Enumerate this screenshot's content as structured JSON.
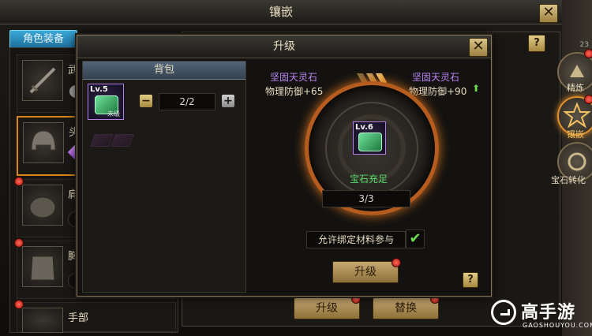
{
  "outer": {
    "title": "镶嵌",
    "close": "✕"
  },
  "left_panel": {
    "tab_label": "角色装备",
    "slots": [
      {
        "name": "武",
        "icon": "sword-icon"
      },
      {
        "name": "头",
        "icon": "helmet-icon"
      },
      {
        "name": "肩",
        "icon": "shoulder-icon"
      },
      {
        "name": "胸",
        "icon": "chest-armor-icon"
      },
      {
        "name": "手部",
        "icon": "gauntlet-icon"
      }
    ]
  },
  "side_tabs": [
    {
      "label": "精炼",
      "icon": "refine-icon"
    },
    {
      "label": "镶嵌",
      "icon": "inlay-icon"
    },
    {
      "label": "宝石转化",
      "icon": "gem-convert-icon"
    }
  ],
  "side_number": "23",
  "bottom_buttons": {
    "upgrade": "升级",
    "replace": "替换"
  },
  "help_label": "?",
  "dialog": {
    "title": "升级",
    "close": "✕",
    "bag": {
      "header": "背包",
      "item": {
        "level": "Lv.5",
        "status": "未级"
      },
      "quantity": "2/2",
      "minus": "−",
      "plus": "+"
    },
    "from_stone": {
      "name": "坚固天灵石",
      "attr": "物理防御+65"
    },
    "to_stone": {
      "name": "坚固天灵石",
      "attr": "物理防御+90",
      "up_arrow": "⬆"
    },
    "center_gem": {
      "level": "Lv.6"
    },
    "gem_status": "宝石充足",
    "count": "3/3",
    "allow_bound": "允许绑定材料参与",
    "allow_checked": "✔",
    "upgrade_button": "升级"
  },
  "watermark": {
    "title": "高手游",
    "url": "GAOSHOUYOU.COM"
  },
  "colors": {
    "accent_orange": "#d9861b",
    "gem_purple": "#b985f2",
    "ok_green": "#55d86a",
    "tab_blue": "#3ba8d8"
  }
}
